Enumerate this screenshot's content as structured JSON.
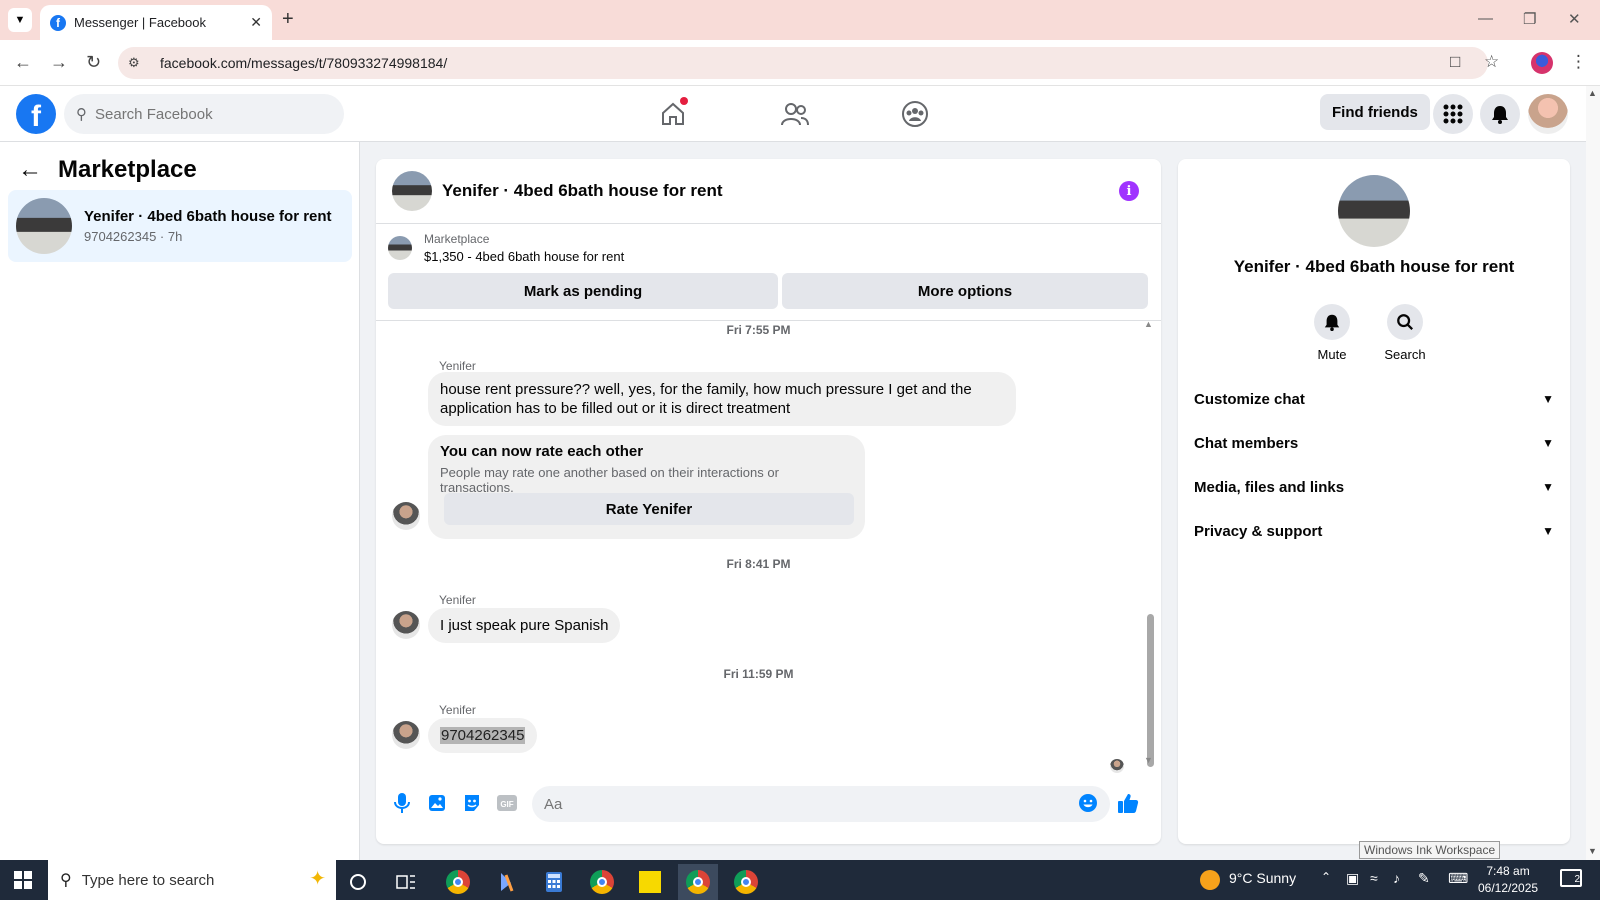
{
  "browser": {
    "tab_title": "Messenger | Facebook",
    "url": "facebook.com/messages/t/780933274998184/"
  },
  "fb_header": {
    "search_placeholder": "Search Facebook",
    "find_friends_label": "Find friends"
  },
  "left_panel": {
    "title": "Marketplace",
    "conversation": {
      "name": "Yenifer · 4bed 6bath house for rent",
      "subtitle": "9704262345 · 7h"
    }
  },
  "chat": {
    "title": "Yenifer · 4bed 6bath house for rent",
    "marketplace_label": "Marketplace",
    "listing": "$1,350 - 4bed 6bath house for rent",
    "mark_pending_label": "Mark as pending",
    "more_options_label": "More options",
    "timestamps": [
      "Fri 7:55 PM",
      "Fri 8:41 PM",
      "Fri 11:59 PM"
    ],
    "sender": "Yenifer",
    "messages": [
      "house rent pressure?? well, yes, for the family, how much pressure I get and the application has to be filled out or it is direct treatment",
      "I just speak pure Spanish",
      "9704262345"
    ],
    "rate_card": {
      "title": "You can now rate each other",
      "subtitle": "People may rate one another based on their interactions or transactions.",
      "button": "Rate Yenifer"
    },
    "composer_placeholder": "Aa"
  },
  "right_panel": {
    "name": "Yenifer · 4bed 6bath house for rent",
    "mute_label": "Mute",
    "search_label": "Search",
    "sections": [
      "Customize chat",
      "Chat members",
      "Media, files and links",
      "Privacy & support"
    ]
  },
  "tooltip": "Windows Ink Workspace",
  "taskbar": {
    "search_placeholder": "Type here to search",
    "weather": "9°C  Sunny",
    "time": "7:48 am",
    "date": "06/12/2025",
    "notification_count": "2"
  },
  "colors": {
    "facebook_blue": "#1877f2",
    "info_purple": "#a033ff",
    "tab_bar": "#f8dcd8"
  }
}
